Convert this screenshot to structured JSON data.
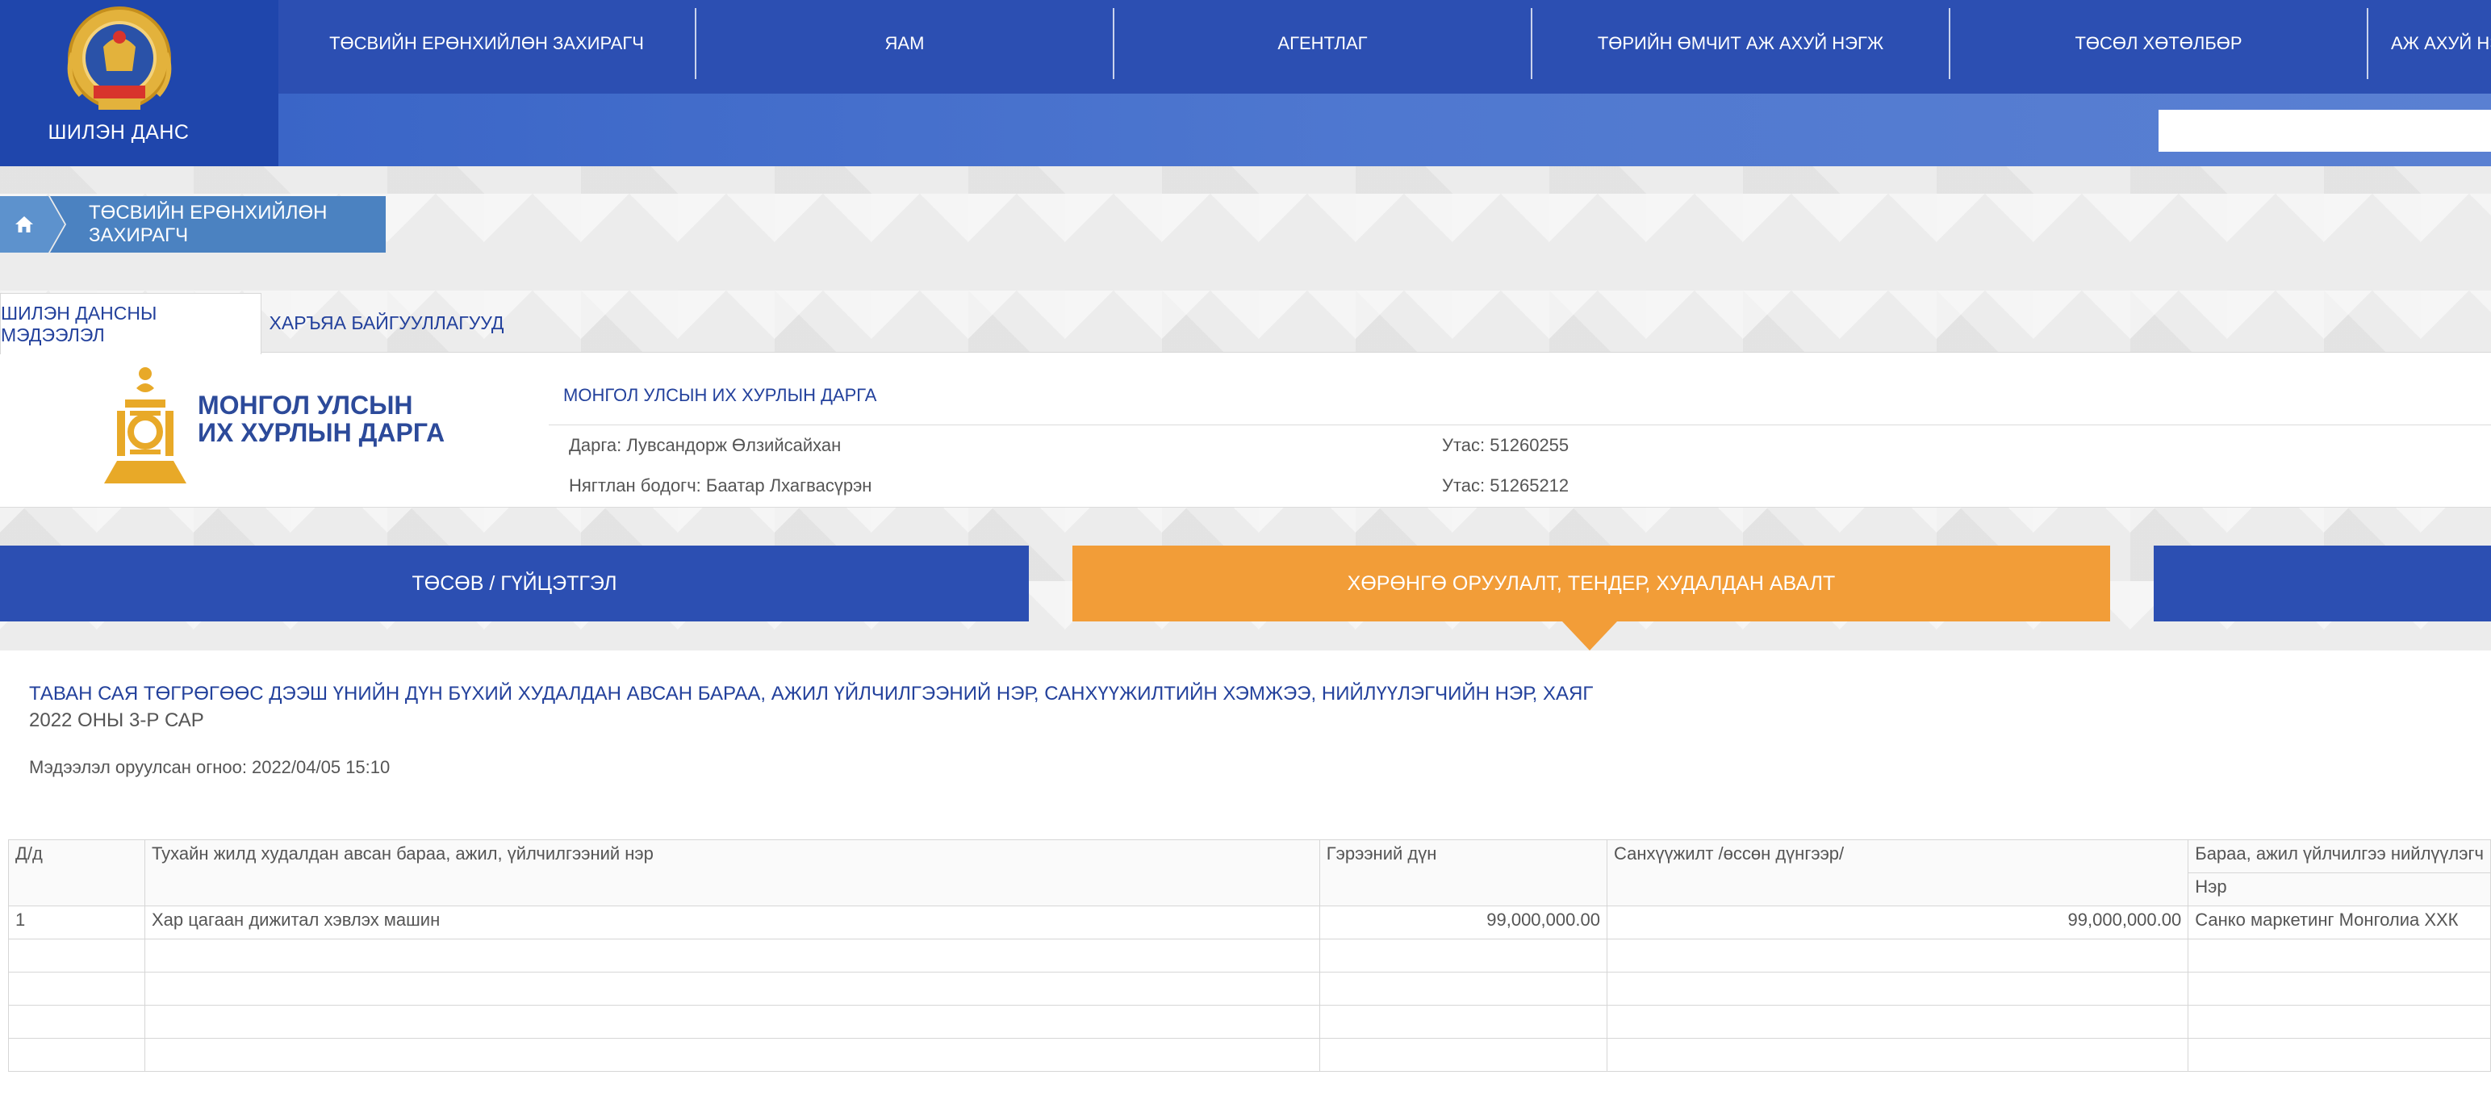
{
  "header": {
    "logo_text": "ШИЛЭН ДАНС",
    "nav": [
      "ТӨСВИЙН ЕРӨНХИЙЛӨН ЗАХИРАГЧ",
      "ЯАМ",
      "АГЕНТЛАГ",
      "ТӨРИЙН ӨМЧИТ АЖ АХУЙ НЭГЖ",
      "ТӨСӨЛ ХӨТӨЛБӨР",
      "АЖ АХУЙ НЭГЖ"
    ]
  },
  "breadcrumb": {
    "item": "ТӨСВИЙН ЕРӨНХИЙЛӨН ЗАХИРАГЧ"
  },
  "tabs": [
    "ШИЛЭН ДАНСНЫ МЭДЭЭЛЭЛ",
    "ХАРЪЯА БАЙГУУЛЛАГУУД"
  ],
  "org": {
    "logo_line1": "МОНГОЛ УЛСЫН",
    "logo_line2": "ИХ ХУРЛЫН ДАРГА",
    "title": "МОНГОЛ УЛСЫН ИХ ХУРЛЫН ДАРГА",
    "head": "Дарга: Лувсандорж Өлзийсайхан",
    "head_phone": "Утас: 51260255",
    "accountant": "Нягтлан бодогч: Баатар Лхагвасүрэн",
    "accountant_phone": "Утас: 51265212"
  },
  "sections": [
    "ТӨСӨВ / ГҮЙЦЭТГЭЛ",
    "ХӨРӨНГӨ ОРУУЛАЛТ, ТЕНДЕР, ХУДАЛДАН АВАЛТ"
  ],
  "content": {
    "title": "ТАВАН САЯ ТӨГРӨГӨӨС ДЭЭШ ҮНИЙН ДҮН БҮХИЙ ХУДАЛДАН АВСАН БАРАА, АЖИЛ ҮЙЛЧИЛГЭЭНИЙ НЭР, САНХҮҮЖИЛТИЙН ХЭМЖЭЭ, НИЙЛҮҮЛЭГЧИЙН НЭР, ХАЯГ",
    "period": "2022 ОНЫ 3-Р САР",
    "uploaded_label": "Мэдээлэл оруулсан огноо:",
    "uploaded_value": "2022/04/05 15:10"
  },
  "table": {
    "headers": {
      "no": "Д/д",
      "name": "Тухайн жилд худалдан авсан бараа, ажил, үйлчилгээний нэр",
      "contract": "Гэрээний дүн",
      "funding": "Санхүүжилт /өссөн дүнгээр/",
      "supplier": "Бараа, ажил үйлчилгээ нийлүүлэгч",
      "supplier_name": "Нэр"
    },
    "rows": [
      {
        "no": "1",
        "name": "Хар цагаан дижитал хэвлэх машин",
        "contract": "99,000,000.00",
        "funding": "99,000,000.00",
        "supplier": "Санко маркетинг Монголиа ХХК"
      }
    ]
  }
}
